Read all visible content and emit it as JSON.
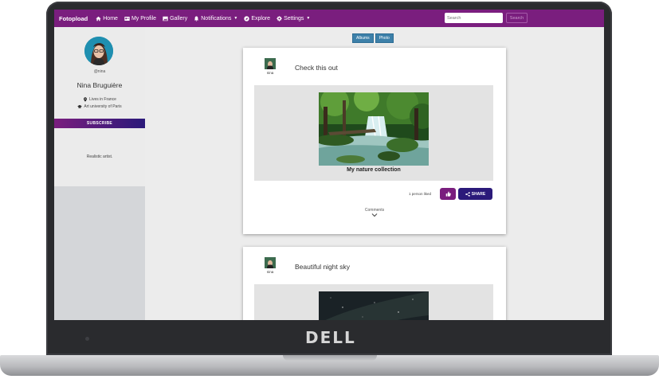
{
  "navbar": {
    "brand": "Fotopload",
    "items": [
      {
        "label": "Home",
        "icon": "home-icon"
      },
      {
        "label": "My Profile",
        "icon": "id-card-icon"
      },
      {
        "label": "Gallery",
        "icon": "image-icon"
      },
      {
        "label": "Notifications",
        "icon": "bell-icon",
        "dropdown": true
      },
      {
        "label": "Explore",
        "icon": "compass-icon"
      },
      {
        "label": "Settings",
        "icon": "gear-icon",
        "dropdown": true
      }
    ],
    "search_placeholder": "Search",
    "search_button": "Search",
    "color": "#7a1e7e"
  },
  "profile": {
    "username": "@nina",
    "fullname": "Nina Bruguière",
    "location": "Lives in France",
    "education": "Art university of Paris",
    "subscribe_label": "SUBSCRIBE",
    "bio": "Realistic artist."
  },
  "view_toggle": [
    "Albums",
    "Photo"
  ],
  "posts": [
    {
      "author": "nina",
      "title": "Check this out",
      "caption": "My nature collection",
      "likes_text": "1 person liked",
      "share_label": "SHARE",
      "comments_label": "Comments"
    },
    {
      "author": "nina",
      "title": "Beautiful night sky"
    }
  ],
  "device": {
    "brand": "DELL"
  },
  "colors": {
    "accent": "#7a1e7e",
    "accent_dark": "#2b1a7a",
    "toggle": "#3d80a9"
  }
}
